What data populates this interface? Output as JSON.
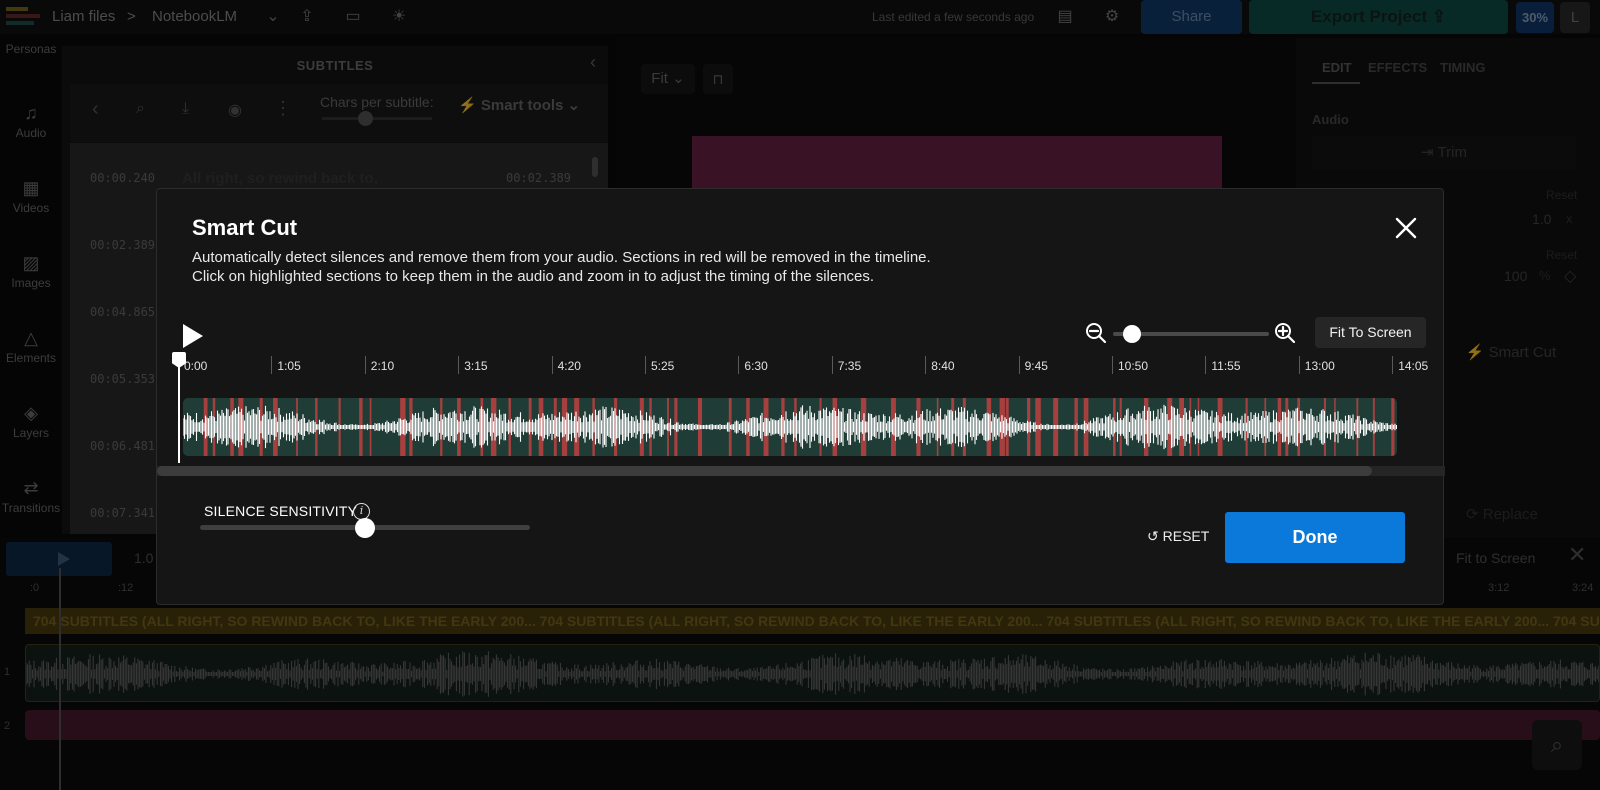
{
  "topbar": {
    "breadcrumb_root": "Liam files",
    "breadcrumb_sep": ">",
    "project_name": "NotebookLM",
    "last_edited": "Last edited a few seconds ago",
    "share_label": "Share",
    "export_label": "Export Project",
    "zoom_percent": "30%",
    "avatar_initial": "L"
  },
  "rail": {
    "items": [
      {
        "label": "Personas",
        "icon": "persona-icon"
      },
      {
        "label": "Audio",
        "icon": "music-note-icon"
      },
      {
        "label": "Videos",
        "icon": "film-icon"
      },
      {
        "label": "Images",
        "icon": "image-icon"
      },
      {
        "label": "Elements",
        "icon": "shapes-icon"
      },
      {
        "label": "Layers",
        "icon": "layers-icon"
      },
      {
        "label": "Transitions",
        "icon": "transitions-icon"
      }
    ]
  },
  "subtitles_panel": {
    "title": "SUBTITLES",
    "chars_label": "Chars per subtitle:",
    "smart_tools_label": "Smart tools",
    "rows": [
      {
        "start": "00:00.240",
        "text": "All right, so rewind back to,",
        "end": "00:02.389"
      },
      {
        "start": "00:02.389"
      },
      {
        "start": "00:04.865"
      },
      {
        "start": "00:05.353"
      },
      {
        "start": "00:06.481"
      },
      {
        "start": "00:07.341"
      }
    ]
  },
  "preview": {
    "fit_label": "Fit"
  },
  "right_panel": {
    "tabs": [
      "EDIT",
      "EFFECTS",
      "TIMING"
    ],
    "section_audio": "Audio",
    "trim_label": "Trim",
    "reset_1": "Reset",
    "speed_value": "1.0",
    "speed_unit": "x",
    "reset_2": "Reset",
    "volume_value": "100",
    "volume_unit": "%",
    "smart_cut_label": "Smart Cut",
    "replace_label": "Replace"
  },
  "timeline": {
    "speed_label": "1.0",
    "fit_to_screen": "Fit to Screen",
    "ruler": [
      ":0",
      ":12",
      "3:12",
      "3:24"
    ],
    "track_numbers": [
      "1",
      "2"
    ],
    "subtitle_track_text": "704 SUBTITLES (ALL RIGHT, SO REWIND BACK TO, LIKE THE EARLY 200...   704 SUBTITLES (ALL RIGHT, SO REWIND BACK TO, LIKE THE EARLY 200...   704 SUBTITLES (ALL RIGHT, SO REWIND BACK TO, LIKE THE EARLY 200...   704 SUBT"
  },
  "modal": {
    "title": "Smart Cut",
    "description_line1": "Automatically detect silences and remove them from your audio. Sections in red will be removed in the timeline.",
    "description_line2": "Click on highlighted sections to keep them in the audio and zoom in to adjust the timing of the silences.",
    "fit_to_screen_label": "Fit To Screen",
    "zoom_level": 0.12,
    "ruler_labels": [
      "0:00",
      "1:05",
      "2:10",
      "3:15",
      "4:20",
      "5:25",
      "6:30",
      "7:35",
      "8:40",
      "9:45",
      "10:50",
      "11:55",
      "13:00",
      "14:05"
    ],
    "playhead_time": "0:00",
    "silence_sensitivity_label": "SILENCE SENSITIVITY",
    "silence_sensitivity_value": 0.5,
    "reset_label": "RESET",
    "done_label": "Done"
  },
  "colors": {
    "accent_blue": "#0b79d9",
    "wave_bg": "#1f3d36",
    "silence_red": "#c0403f",
    "waveform": "#ffffff"
  }
}
